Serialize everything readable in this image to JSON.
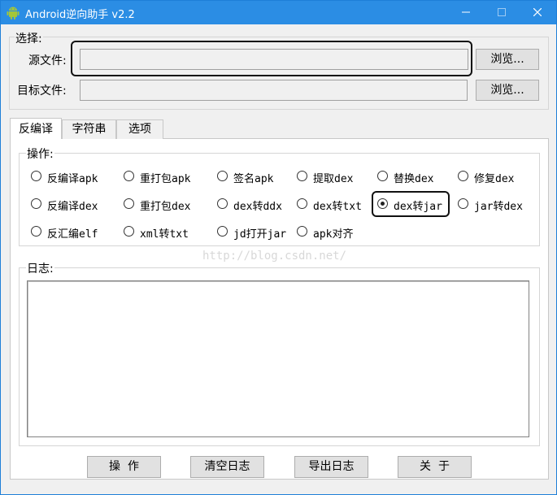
{
  "window": {
    "title": "Android逆向助手 v2.2"
  },
  "select_group": {
    "label": "选择:",
    "source_label": "源文件:",
    "source_value": "",
    "target_label": "目标文件:",
    "target_value": "",
    "browse_label": "浏览..."
  },
  "tabs": [
    "反编译",
    "字符串",
    "选项"
  ],
  "operations": {
    "label": "操作:",
    "selected": "dex转jar",
    "options": [
      [
        "反编译apk",
        "重打包apk",
        "签名apk",
        "提取dex",
        "替换dex",
        "修复dex"
      ],
      [
        "反编译dex",
        "重打包dex",
        "dex转ddx",
        "dex转txt",
        "dex转jar",
        "jar转dex"
      ],
      [
        "反汇编elf",
        "xml转txt",
        "jd打开jar",
        "apk对齐"
      ]
    ]
  },
  "log": {
    "label": "日志:",
    "content": ""
  },
  "watermark": "http://blog.csdn.net/",
  "buttons": {
    "operate": "操  作",
    "clear_log": "清空日志",
    "export_log": "导出日志",
    "about": "关  于"
  }
}
